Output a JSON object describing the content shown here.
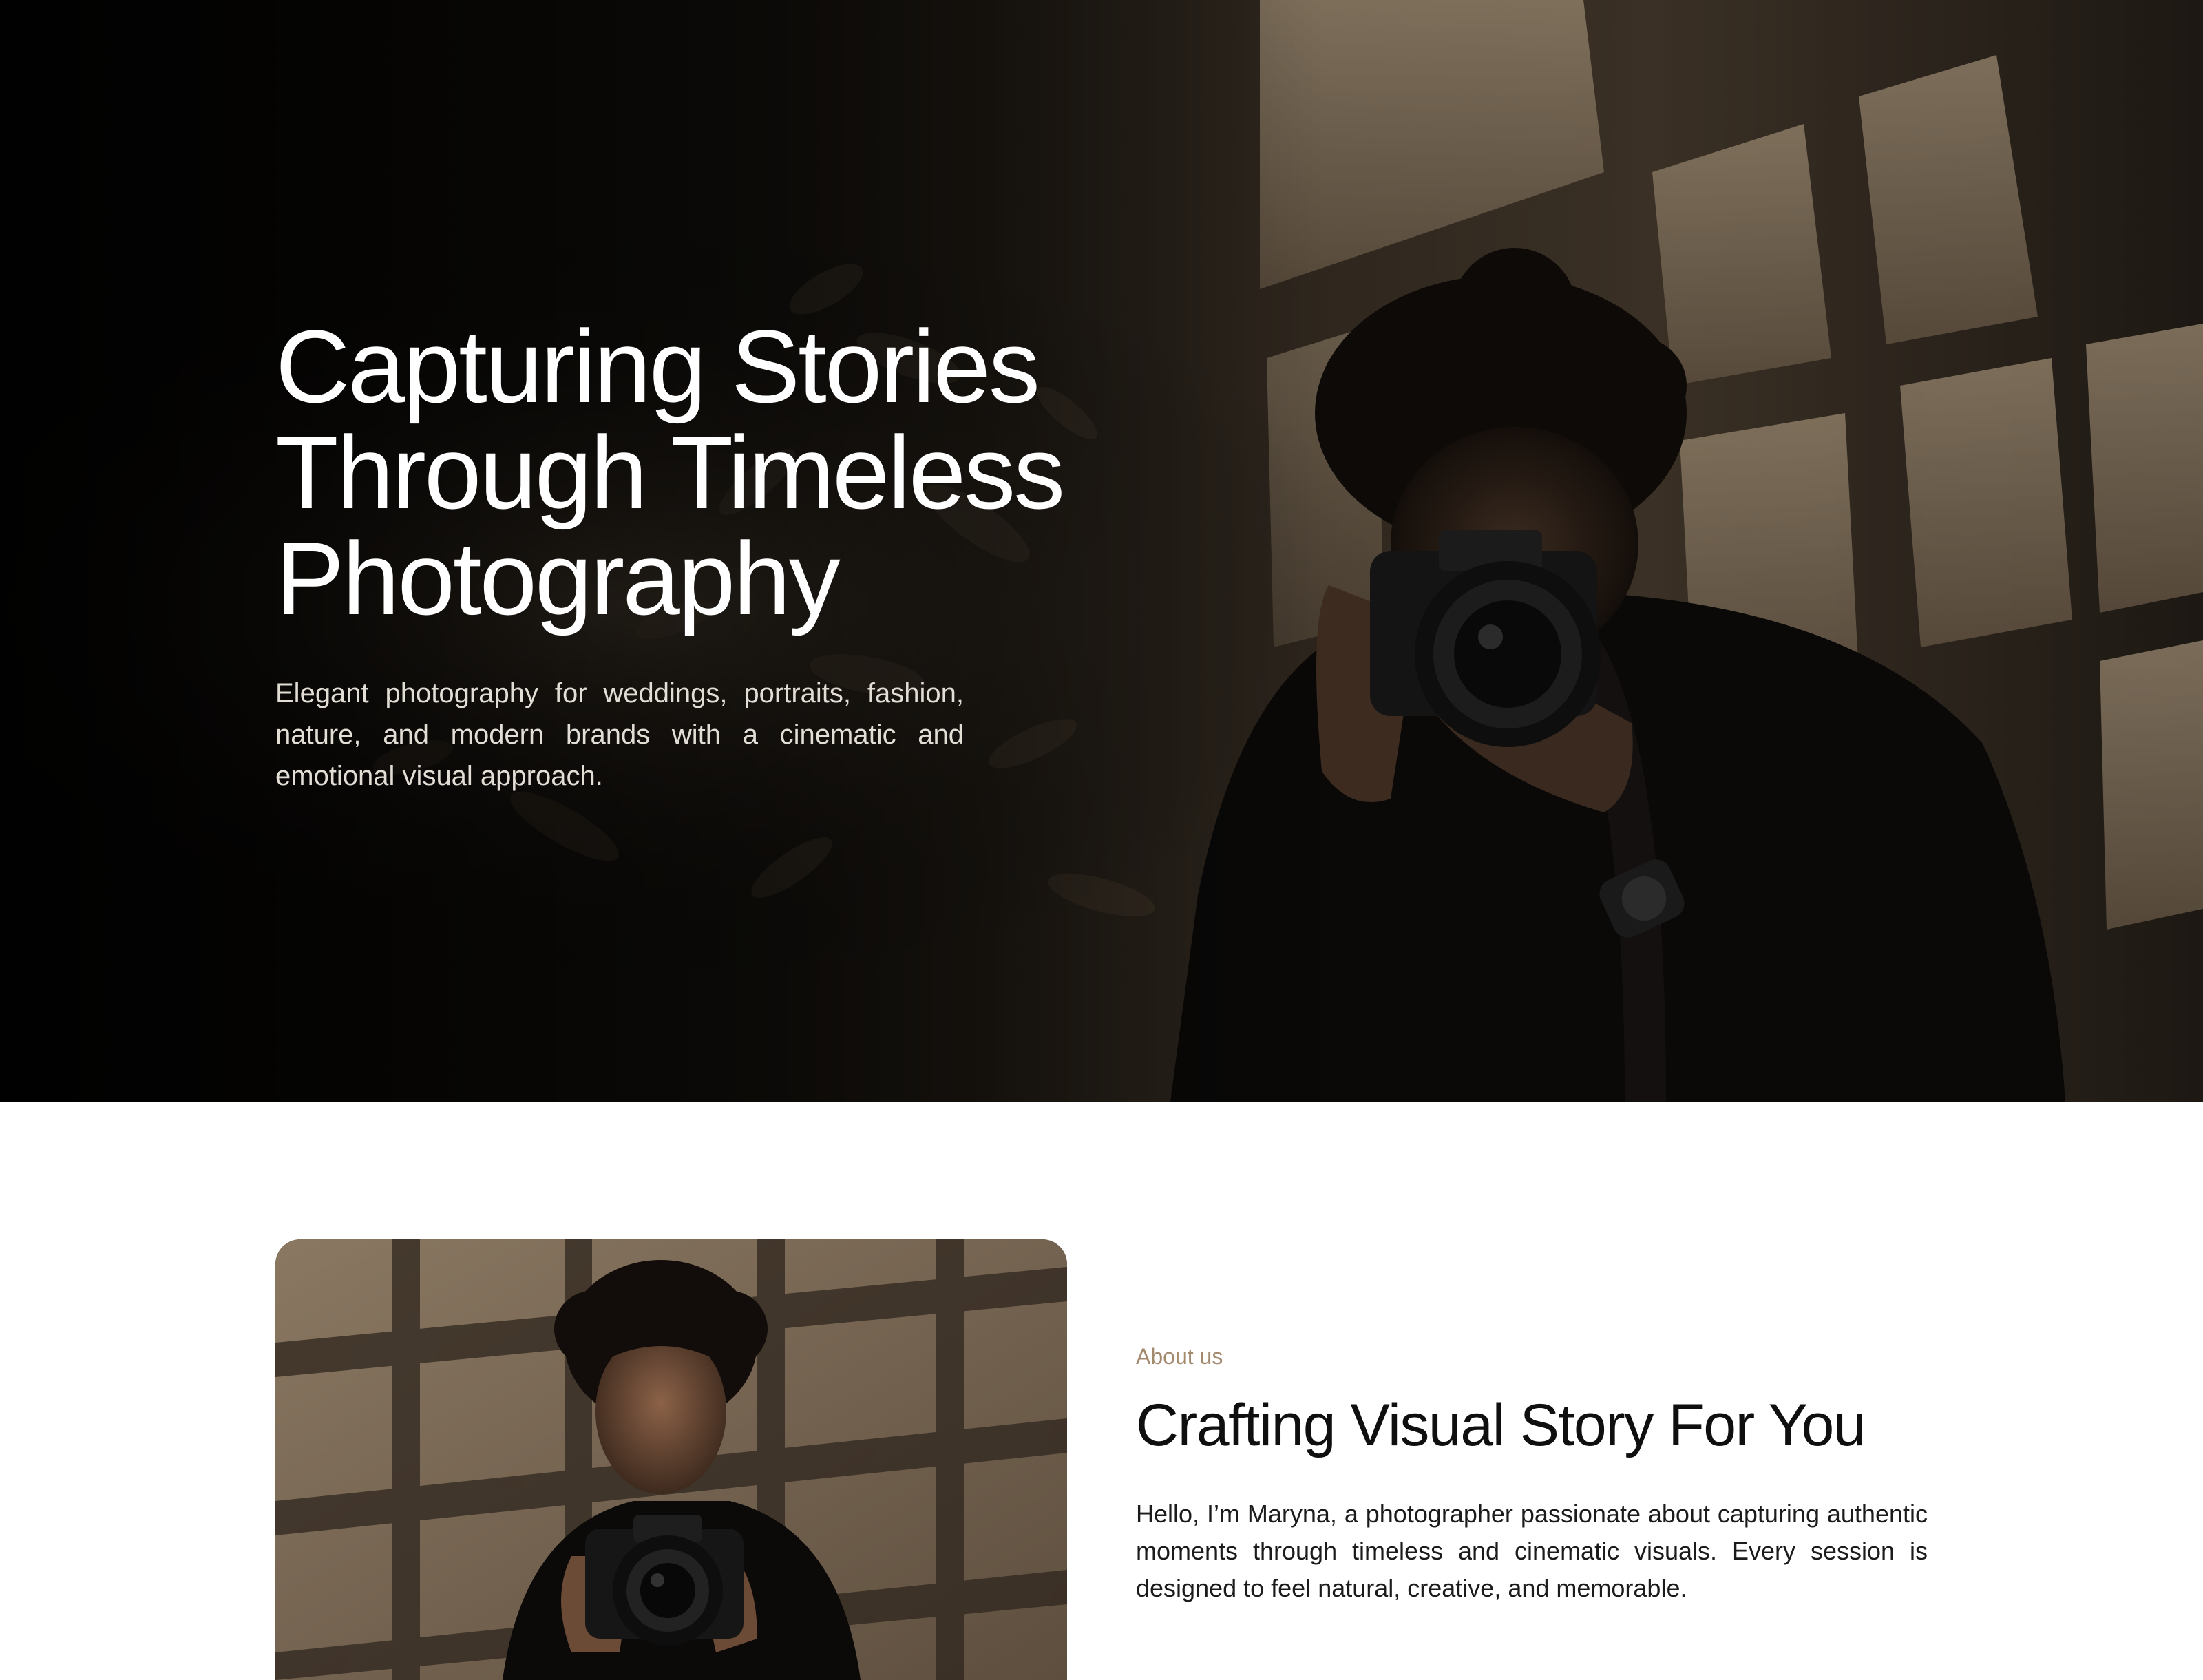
{
  "hero": {
    "title_lines": [
      "Capturing Stories",
      "Through Timeless",
      "Photography"
    ],
    "subtitle": "Elegant photography for weddings, portraits, fashion, nature, and modern brands with a cinematic and emotional visual approach.",
    "image_alt": "photographer-holding-camera-in-window-shadows"
  },
  "about": {
    "eyebrow": "About us",
    "heading": "Crafting Visual Story For You",
    "body": "Hello, I’m Maryna, a photographer passionate about capturing authentic moments through timeless and cinematic visuals. Every session is designed to feel natural, creative, and memorable.",
    "image_alt": "portrait-photographer-with-camera"
  },
  "colors": {
    "hero_bg": "#0b0907",
    "accent": "#a38a6e",
    "heading_dark": "#0f0f0f",
    "page_bg": "#ffffff"
  }
}
